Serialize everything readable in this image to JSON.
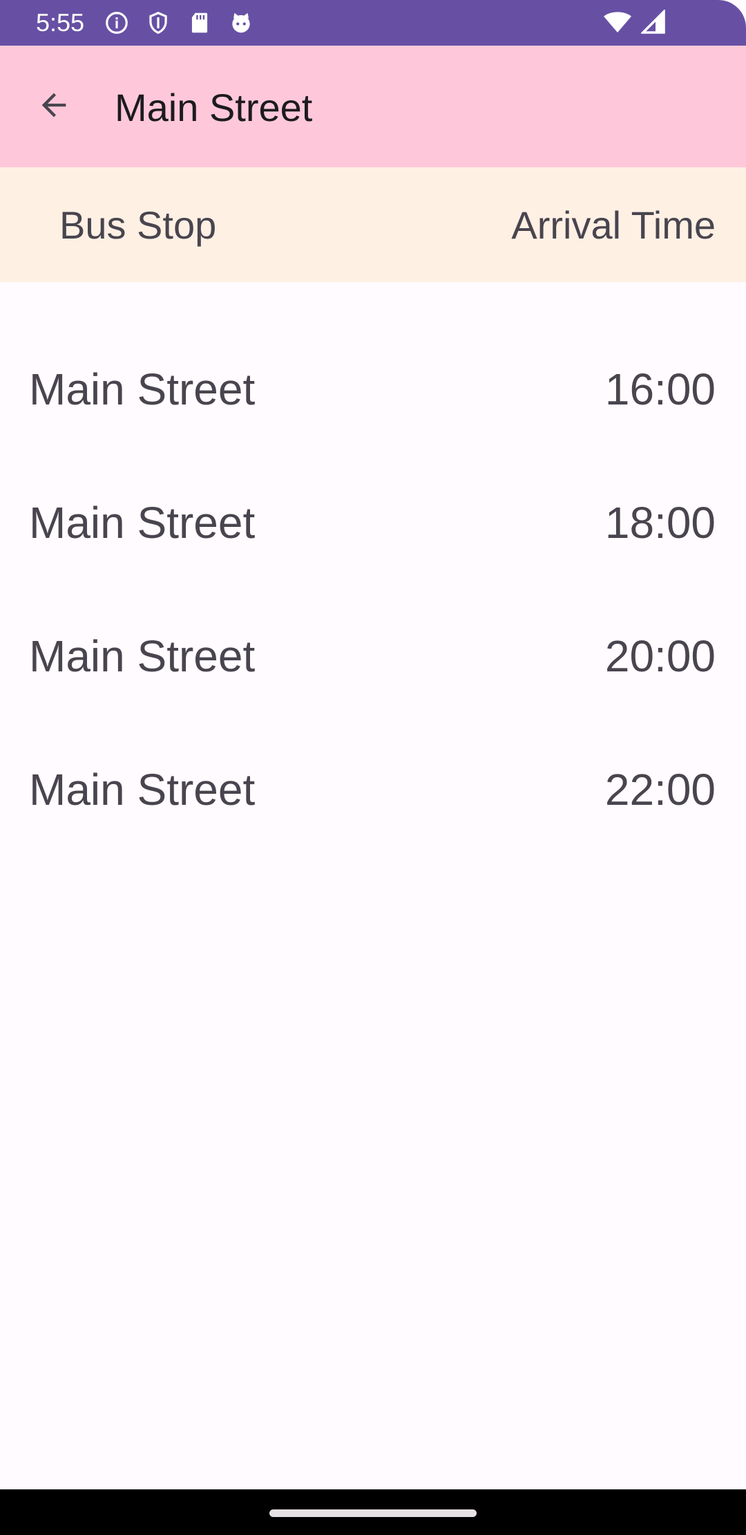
{
  "status_bar": {
    "time": "5:55",
    "icons_left": [
      "info-icon",
      "shield-icon",
      "sd-card-icon",
      "cat-face-icon"
    ],
    "icons_right": [
      "wifi-icon",
      "signal-icon"
    ]
  },
  "app_bar": {
    "back_icon": "arrow-back-icon",
    "title": "Main Street"
  },
  "table_header": {
    "bus_stop": "Bus Stop",
    "arrival_time": "Arrival Time"
  },
  "arrivals": [
    {
      "stop": "Main Street",
      "time": "16:00"
    },
    {
      "stop": "Main Street",
      "time": "18:00"
    },
    {
      "stop": "Main Street",
      "time": "20:00"
    },
    {
      "stop": "Main Street",
      "time": "22:00"
    }
  ],
  "colors": {
    "status_bar": "#6750A4",
    "app_bar": "#FFC8DA",
    "header_row": "#FFF0E4",
    "background": "#FFFBFE",
    "text": "#49454F"
  }
}
